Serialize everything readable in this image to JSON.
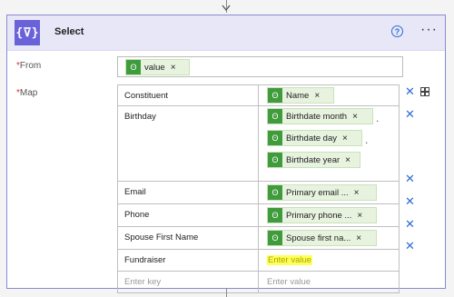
{
  "card": {
    "icon_glyph": "{⊽}",
    "title": "Select",
    "help_glyph": "?",
    "more_glyph": "···"
  },
  "from": {
    "label": "From",
    "required_mark": "*",
    "token": {
      "label": "value",
      "remove": "×"
    }
  },
  "map": {
    "label": "Map",
    "required_mark": "*",
    "rows": [
      {
        "key": "Constituent",
        "values": [
          "Name"
        ]
      },
      {
        "key": "Birthday",
        "values": [
          "Birthdate month",
          "Birthdate day",
          "Birthdate year"
        ]
      },
      {
        "key": "Email",
        "values": [
          "Primary email ..."
        ]
      },
      {
        "key": "Phone",
        "values": [
          "Primary phone ..."
        ]
      },
      {
        "key": "Spouse First Name",
        "values": [
          "Spouse first na..."
        ]
      },
      {
        "key": "Fundraiser",
        "value_placeholder": "Enter value"
      }
    ],
    "new_row": {
      "key_placeholder": "Enter key",
      "value_placeholder": "Enter value"
    },
    "remove_glyph": "×",
    "delete_glyph": "✕",
    "token_icon_glyph": "ʘ"
  },
  "icons": {
    "operation": "select-operation-icon",
    "help": "help-icon",
    "more": "more-options-icon",
    "token": "dynamic-content-icon",
    "delete": "delete-row-icon",
    "switch": "switch-to-text-mode-icon",
    "connector": "chevron-down-icon"
  },
  "colors": {
    "header_bg": "#e8e7f7",
    "operation_icon_bg": "#6a62d8",
    "token_bg": "#e7f3df",
    "token_icon_bg": "#3f9b3c",
    "delete_icon": "#2b6cd6",
    "highlight": "#ffff5a"
  }
}
